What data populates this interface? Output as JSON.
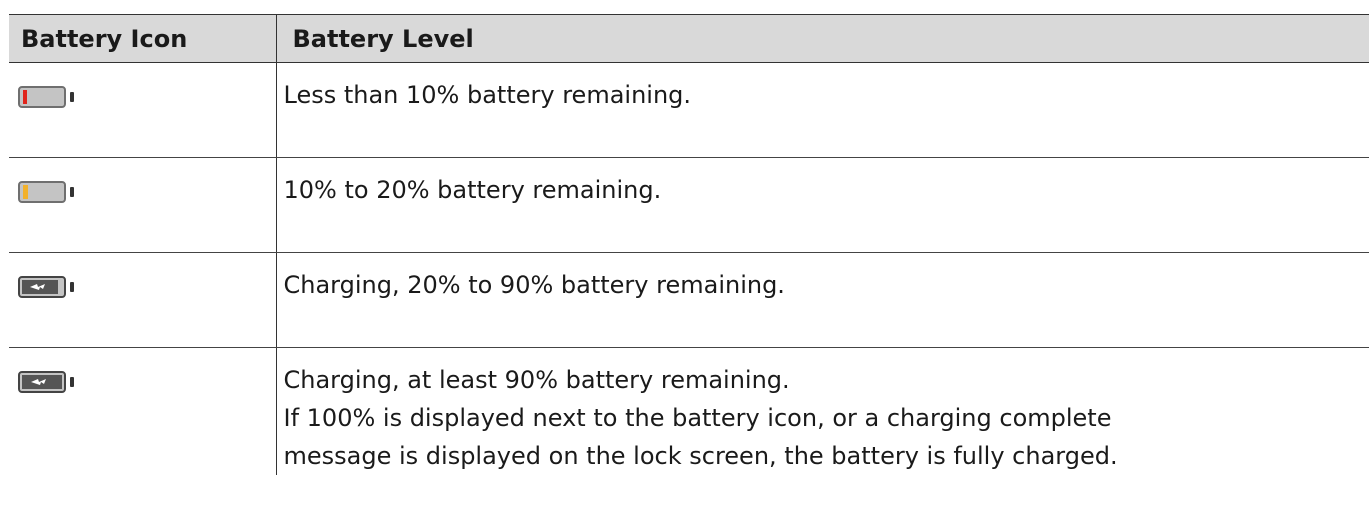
{
  "table": {
    "headers": {
      "icon": "Battery Icon",
      "level": "Battery Level"
    },
    "rows": [
      {
        "icon": "battery-low-red-icon",
        "lines": [
          "Less than 10% battery remaining."
        ]
      },
      {
        "icon": "battery-low-orange-icon",
        "lines": [
          "10% to 20% battery remaining."
        ]
      },
      {
        "icon": "battery-charging-icon",
        "lines": [
          "Charging, 20% to 90% battery remaining."
        ]
      },
      {
        "icon": "battery-charging-full-icon",
        "lines": [
          "Charging, at least 90% battery remaining.",
          "If 100% is displayed next to the battery icon, or a charging complete",
          "message is displayed on the lock screen, the battery is fully charged."
        ]
      }
    ]
  },
  "colors": {
    "header_bg": "#d9d9d9",
    "battery_body": "#c4c4c4",
    "battery_dark": "#555555",
    "low_red": "#e0241b",
    "low_orange": "#f2b12b"
  }
}
